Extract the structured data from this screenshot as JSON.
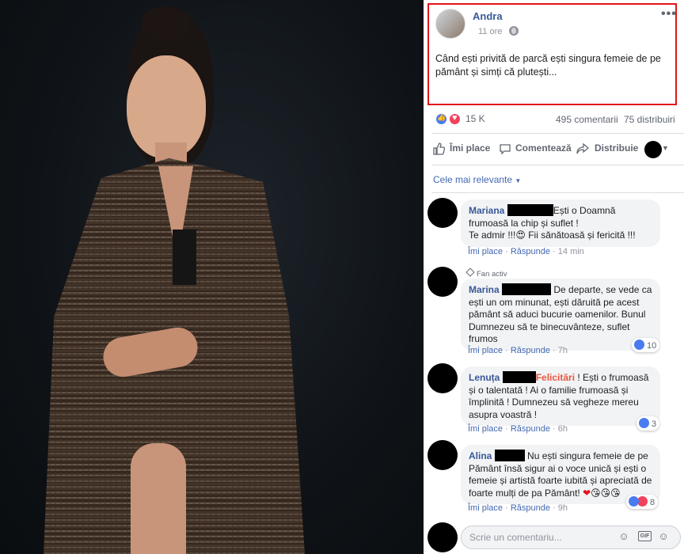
{
  "post": {
    "author": "Andra",
    "time": "11 ore",
    "text": "Când ești privită de parcă ești singura femeie de pe pământ și simți că plutești...",
    "reactions_count": "15 K",
    "comments_count": "495 comentarii",
    "shares_count": "75 distribuiri"
  },
  "actions": {
    "like": "Îmi place",
    "comment": "Comentează",
    "share": "Distribuie"
  },
  "sort_label": "Cele mai relevante",
  "comments": [
    {
      "name": "Mariana",
      "text_a": "Ești o Doamnă frumoasă la chip și suflet !",
      "text_b": "Te admir !!!",
      "text_c": " Fii sănătoasă și fericită !!!",
      "like": "Îmi place",
      "reply": "Răspunde",
      "time": "14 min"
    },
    {
      "badge": "Fan activ",
      "name": "Marina",
      "text": "De departe, se vede ca ești un om minunat, ești dăruită pe acest pământ să aduci bucurie oamenilor. Bunul Dumnezeu să te binecuvânteze, suflet frumos",
      "like": "Îmi place",
      "reply": "Răspunde",
      "time": "7h",
      "reactions": "10"
    },
    {
      "name": "Lenuța",
      "highlight": "Felicitări",
      "text": " ! Ești o frumoasă și o talentată ! Ai o familie frumoasă și împlinită ! Dumnezeu să vegheze mereu asupra voastră !",
      "like": "Îmi place",
      "reply": "Răspunde",
      "time": "6h",
      "reactions": "3"
    },
    {
      "name": "Alina",
      "text": "Nu ești singura femeie de pe Pământ însă sigur ai o voce unică și ești o femeie și artistă foarte iubită și apreciată de foarte mulți de pa Pământ!",
      "like": "Îmi place",
      "reply": "Răspunde",
      "time": "9h",
      "reactions": "8"
    }
  ],
  "composer": {
    "placeholder": "Scrie un comentariu..."
  },
  "colors": {
    "link": "#385898",
    "highlight_border": "#e0141b",
    "felicitari": "#e9573f"
  }
}
